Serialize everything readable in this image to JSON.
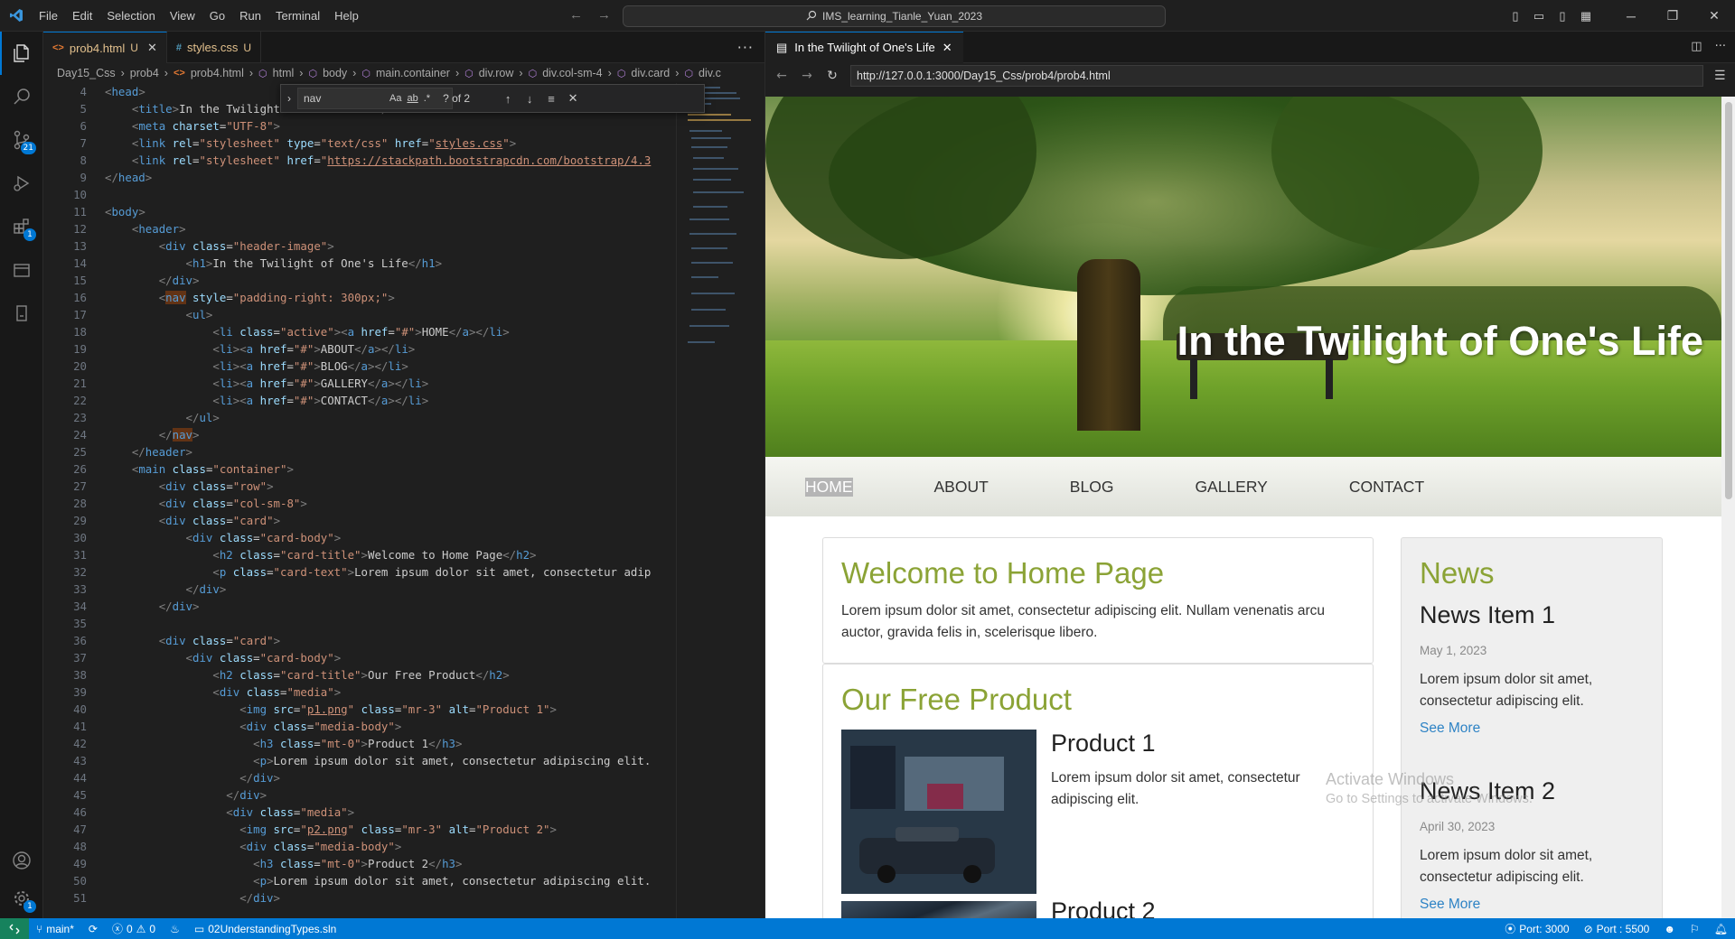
{
  "titlebar": {
    "menu": [
      "File",
      "Edit",
      "Selection",
      "View",
      "Go",
      "Run",
      "Terminal",
      "Help"
    ],
    "command_center": "IMS_learning_Tianle_Yuan_2023"
  },
  "activity": {
    "scm_badge": "21",
    "extensions_badge": "1",
    "accounts_badge": "1"
  },
  "editor": {
    "tabs": [
      {
        "icon": "<>",
        "name": "prob4.html",
        "status": "U"
      },
      {
        "icon": "#",
        "name": "styles.css",
        "status": "U"
      }
    ],
    "breadcrumb": [
      "Day15_Css",
      "prob4",
      "prob4.html",
      "html",
      "body",
      "main.container",
      "div.row",
      "div.col-sm-4",
      "div.card",
      "div.c"
    ],
    "find": {
      "query": "nav",
      "count": "? of 2",
      "opt_case": "Aa",
      "opt_word": "ab",
      "opt_regex": ".*"
    },
    "lines": [
      {
        "n": "4"
      },
      {
        "n": "5"
      },
      {
        "n": "6"
      },
      {
        "n": "7"
      },
      {
        "n": "8"
      },
      {
        "n": "9"
      },
      {
        "n": "10"
      },
      {
        "n": "11"
      },
      {
        "n": "12"
      },
      {
        "n": "13"
      },
      {
        "n": "14"
      },
      {
        "n": "15"
      },
      {
        "n": "16"
      },
      {
        "n": "17"
      },
      {
        "n": "18"
      },
      {
        "n": "19"
      },
      {
        "n": "20"
      },
      {
        "n": "21"
      },
      {
        "n": "22"
      },
      {
        "n": "23"
      },
      {
        "n": "24"
      },
      {
        "n": "25"
      },
      {
        "n": "26"
      },
      {
        "n": "27"
      },
      {
        "n": "28"
      },
      {
        "n": "29"
      },
      {
        "n": "30"
      },
      {
        "n": "31"
      },
      {
        "n": "32"
      },
      {
        "n": "33"
      },
      {
        "n": "34"
      },
      {
        "n": "35"
      },
      {
        "n": "36"
      },
      {
        "n": "37"
      },
      {
        "n": "38"
      },
      {
        "n": "39"
      },
      {
        "n": "40"
      },
      {
        "n": "41"
      },
      {
        "n": "42"
      },
      {
        "n": "43"
      },
      {
        "n": "44"
      },
      {
        "n": "45"
      },
      {
        "n": "46"
      },
      {
        "n": "47"
      },
      {
        "n": "48"
      },
      {
        "n": "49"
      },
      {
        "n": "50"
      },
      {
        "n": "51"
      }
    ]
  },
  "browser": {
    "tab_title": "In the Twilight of One's Life",
    "url": "http://127.0.0.1:3000/Day15_Css/prob4/prob4.html",
    "page": {
      "hero_title": "In the Twilight of One's Life",
      "nav": [
        "HOME",
        "ABOUT",
        "BLOG",
        "GALLERY",
        "CONTACT"
      ],
      "welcome": {
        "title": "Welcome to Home Page",
        "text": "Lorem ipsum dolor sit amet, consectetur adipiscing elit. Nullam venenatis arcu auctor, gravida felis in, scelerisque libero."
      },
      "product": {
        "title": "Our Free Product",
        "items": [
          {
            "name": "Product 1",
            "text": "Lorem ipsum dolor sit amet, consectetur adipiscing elit."
          },
          {
            "name": "Product 2"
          }
        ]
      },
      "news": {
        "title": "News",
        "items": [
          {
            "title": "News Item 1",
            "date": "May 1, 2023",
            "text": "Lorem ipsum dolor sit amet, consectetur adipiscing elit.",
            "link": "See More"
          },
          {
            "title": "News Item 2",
            "date": "April 30, 2023",
            "text": "Lorem ipsum dolor sit amet, consectetur adipiscing elit.",
            "link": "See More"
          }
        ]
      }
    },
    "watermark": {
      "line1": "Activate Windows",
      "line2": "Go to Settings to activate Windows."
    }
  },
  "statusbar": {
    "branch": "main*",
    "problems": "0",
    "warnings": "0",
    "solution": "02UnderstandingTypes.sln",
    "port1": "Port: 3000",
    "port2": "Port : 5500"
  },
  "colors": {
    "accent": "#0078d4",
    "statusbar": "#0078d4",
    "card_title": "#8ba336",
    "link": "#2e83c5"
  }
}
